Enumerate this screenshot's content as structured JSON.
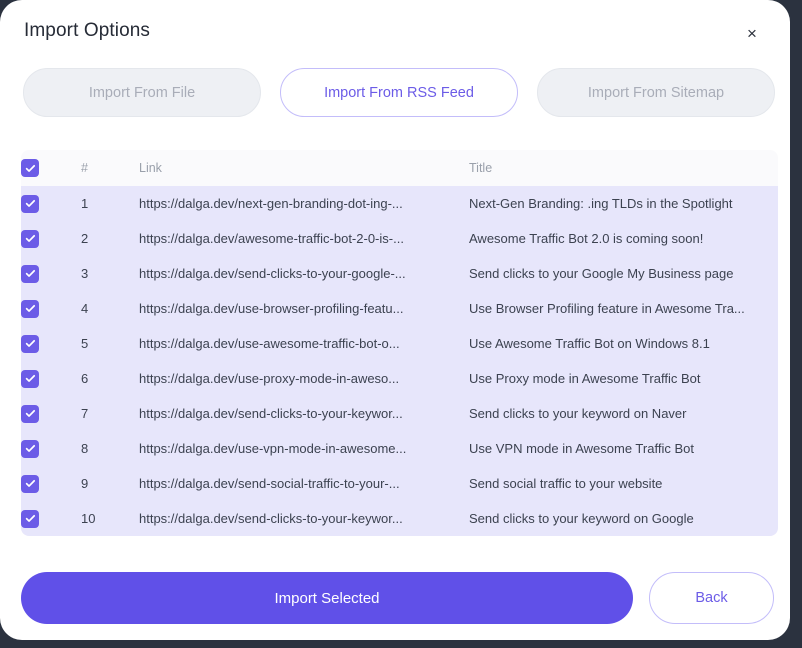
{
  "dialog": {
    "title": "Import Options",
    "close_icon": "close-icon",
    "close_label": "×"
  },
  "tabs": [
    {
      "label": "Import From File",
      "active": false
    },
    {
      "label": "Import From RSS Feed",
      "active": true
    },
    {
      "label": "Import From Sitemap",
      "active": false
    }
  ],
  "table": {
    "headers": {
      "select_all": "",
      "number": "#",
      "link": "Link",
      "title": "Title"
    },
    "select_all_checked": true,
    "rows": [
      {
        "num": "1",
        "checked": true,
        "link": "https://dalga.dev/next-gen-branding-dot-ing-...",
        "title": "Next-Gen Branding: .ing TLDs in the Spotlight"
      },
      {
        "num": "2",
        "checked": true,
        "link": "https://dalga.dev/awesome-traffic-bot-2-0-is-...",
        "title": "Awesome Traffic Bot 2.0 is coming soon!"
      },
      {
        "num": "3",
        "checked": true,
        "link": "https://dalga.dev/send-clicks-to-your-google-...",
        "title": "Send clicks to your Google My Business page"
      },
      {
        "num": "4",
        "checked": true,
        "link": "https://dalga.dev/use-browser-profiling-featu...",
        "title": "Use Browser Profiling feature in Awesome Tra..."
      },
      {
        "num": "5",
        "checked": true,
        "link": "https://dalga.dev/use-awesome-traffic-bot-o...",
        "title": "Use Awesome Traffic Bot on Windows 8.1"
      },
      {
        "num": "6",
        "checked": true,
        "link": "https://dalga.dev/use-proxy-mode-in-aweso...",
        "title": "Use Proxy mode in Awesome Traffic Bot"
      },
      {
        "num": "7",
        "checked": true,
        "link": "https://dalga.dev/send-clicks-to-your-keywor...",
        "title": "Send clicks to your keyword on Naver"
      },
      {
        "num": "8",
        "checked": true,
        "link": "https://dalga.dev/use-vpn-mode-in-awesome...",
        "title": "Use VPN mode in Awesome Traffic Bot"
      },
      {
        "num": "9",
        "checked": true,
        "link": "https://dalga.dev/send-social-traffic-to-your-...",
        "title": "Send social traffic to your website"
      },
      {
        "num": "10",
        "checked": true,
        "link": "https://dalga.dev/send-clicks-to-your-keywor...",
        "title": "Send clicks to your keyword on Google"
      }
    ]
  },
  "footer": {
    "primary_label": "Import Selected",
    "secondary_label": "Back"
  },
  "colors": {
    "accent": "#6c5ce7",
    "primary_button": "#6050e8",
    "row_background": "#e7e6fb",
    "header_background": "#fafafc",
    "backdrop": "#2b323f"
  }
}
